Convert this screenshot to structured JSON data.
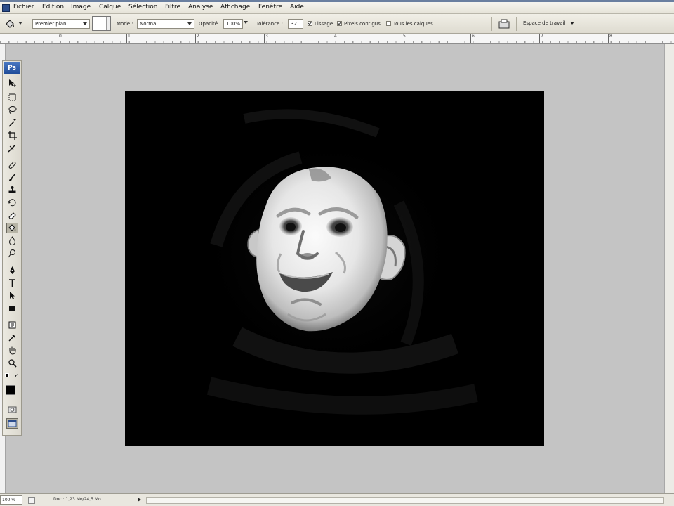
{
  "menu": [
    "Fichier",
    "Edition",
    "Image",
    "Calque",
    "Sélection",
    "Filtre",
    "Analyse",
    "Affichage",
    "Fenêtre",
    "Aide"
  ],
  "options": {
    "fill_source": "Premier plan",
    "mode_label": "Mode :",
    "mode_value": "Normal",
    "opacity_label": "Opacité :",
    "opacity_value": "100%",
    "tolerance_label": "Tolérance :",
    "tolerance_value": "32",
    "lissage_label": "Lissage",
    "lissage_checked": true,
    "contigus_label": "Pixels contigus",
    "contigus_checked": true,
    "tous_calques_label": "Tous les calques",
    "tous_calques_checked": false,
    "workspace_label": "Espace de travail"
  },
  "ruler": [
    "0",
    "1",
    "2",
    "3",
    "4",
    "5",
    "6",
    "7",
    "8"
  ],
  "tools": {
    "logo": "Ps",
    "active_tool": "paint-bucket-icon",
    "foreground_color": "#000000"
  },
  "status": {
    "zoom": "100 %",
    "doc_info": "Doc : 1,23 Mo/24,5 Mo"
  }
}
